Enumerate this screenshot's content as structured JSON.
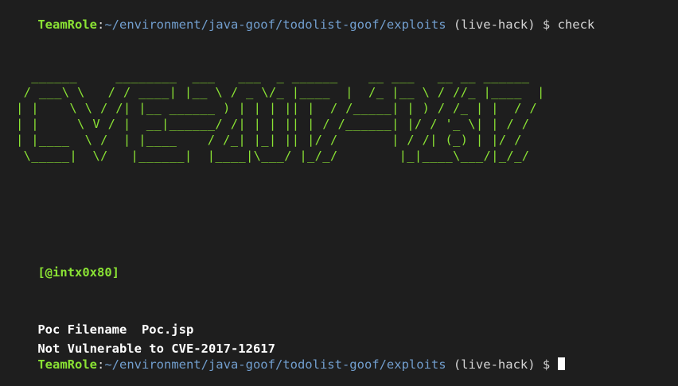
{
  "prompt": {
    "user_host": "TeamRole",
    "separator": ":",
    "path": "~/environment/java-goof/todolist-goof/exploits",
    "venv": " (live-hack) ",
    "symbol": "$ ",
    "command": "check"
  },
  "banner_ascii": "  ______     ________  ___   ___  _ ______    __ ___   __ __ ______\n / ___\\ \\   / / ____| |__ \\ / _ \\/_ |____  |  /_ |__ \\ / //_ |____  |\n| |    \\ \\ / /| |__ ______ ) | | | || |  / /_____| | ) / /_ | |  / /\n| |     \\ V / |  __|______/ /| | | || | / /______| |/ / '_ \\| | / /\n| |____  \\ /  | |____    / /_| |_| || |/ /       | / /| (_) | |/ /\n \\_____|  \\/   |______|  |____|\\___/ |_/_/        |_|____\\___/|_/_/",
  "handle": "[@intx0x80]",
  "result": {
    "poc_line": "Poc Filename  Poc.jsp",
    "status_line": "Not Vulnerable to CVE-2017-12617"
  },
  "next_prompt": {
    "user_host": "TeamRole",
    "separator": ":",
    "path": "~/environment/java-goof/todolist-goof/exploits",
    "venv": " (live-hack) ",
    "symbol": "$ "
  },
  "colors": {
    "background": "#1e1e1e",
    "user": "#8ae234",
    "path": "#729fcf",
    "text": "#d4d4d4"
  }
}
